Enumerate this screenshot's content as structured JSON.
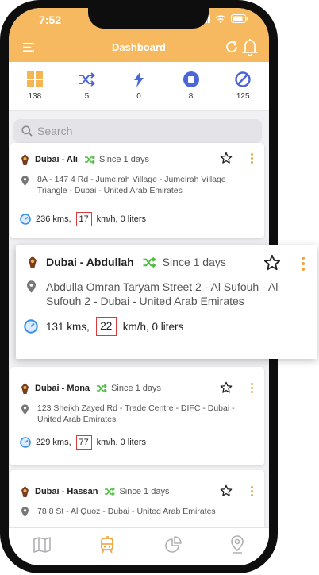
{
  "status_bar": {
    "time": "7:52"
  },
  "header": {
    "title": "Dashboard"
  },
  "stats": [
    {
      "icon": "grid-icon",
      "count": "138"
    },
    {
      "icon": "shuffle-icon",
      "count": "5"
    },
    {
      "icon": "bolt-icon",
      "count": "0"
    },
    {
      "icon": "stop-icon",
      "count": "8"
    },
    {
      "icon": "block-icon",
      "count": "125"
    }
  ],
  "search": {
    "placeholder": "Search"
  },
  "vehicles": [
    {
      "name": "Dubai - Ali",
      "since": "Since 1 days",
      "address": "8A - 147 4 Rd - Jumeirah Village - Jumeirah Village Triangle - Dubai - United Arab Emirates",
      "kms": "236 kms,",
      "speed": "17",
      "unit": "km/h, 0 liters"
    },
    {
      "name": "Dubai - Abdullah",
      "since": "Since 1 days",
      "address": "Abdulla Omran Taryam Street 2 - Al Sufouh - Al Sufouh 2 - Dubai - United Arab Emirates",
      "kms": "131 kms,",
      "speed": "22",
      "unit": "km/h, 0 liters"
    },
    {
      "name": "Dubai - Mona",
      "since": "Since 1 days",
      "address": "123 Sheikh Zayed Rd - Trade Centre - DIFC - Dubai - United Arab Emirates",
      "kms": "229 kms,",
      "speed": "77",
      "unit": "km/h, 0 liters"
    },
    {
      "name": "Dubai - Hassan",
      "since": "Since 1 days",
      "address": "78 8 St - Al Quoz - Dubai - United Arab Emirates",
      "kms": "",
      "speed": "",
      "unit": ""
    }
  ],
  "tabbar": [
    {
      "icon": "map-icon",
      "active": false
    },
    {
      "icon": "tram-icon",
      "active": true
    },
    {
      "icon": "chart-icon",
      "active": false
    },
    {
      "icon": "location-pin-icon",
      "active": false
    }
  ],
  "colors": {
    "accent": "#f6b960",
    "shuffle_green": "#4cbd3d",
    "stat_blue": "#4a66d8",
    "speed_border": "#d93b3b",
    "kebab_orange": "#f0a33a"
  }
}
